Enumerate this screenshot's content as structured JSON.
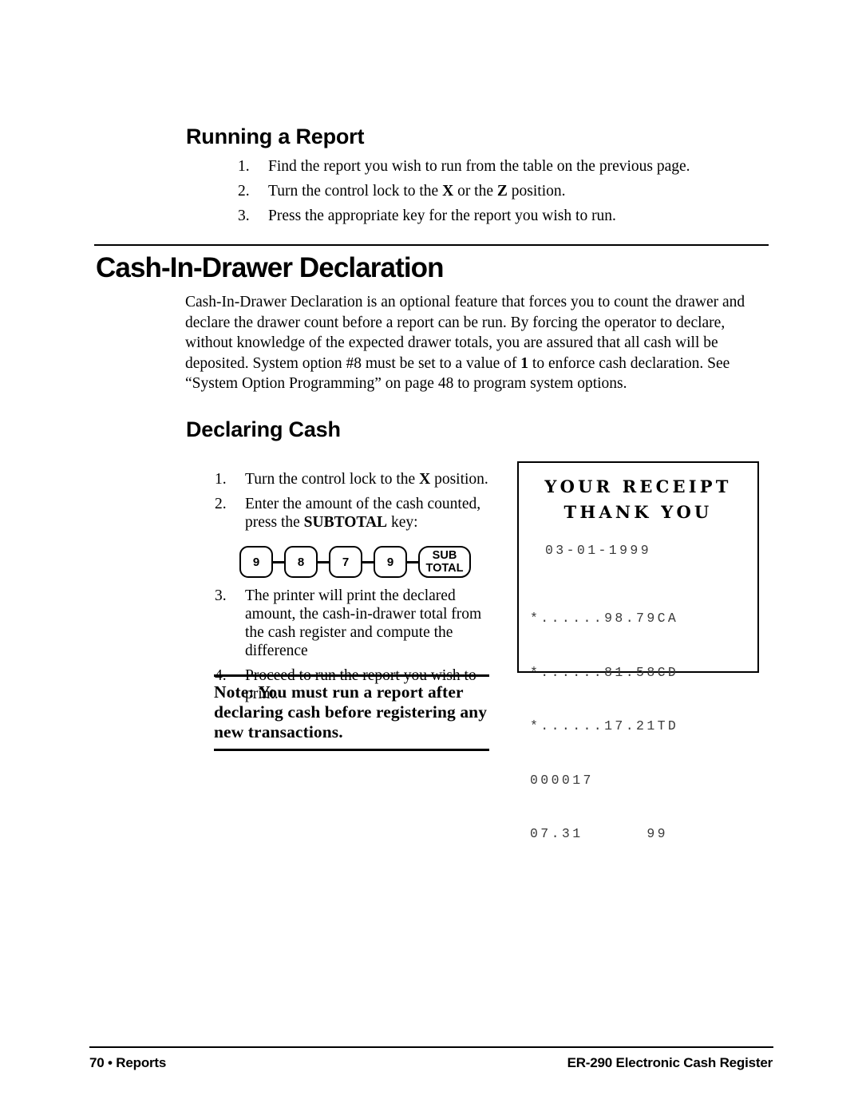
{
  "sections": {
    "running_report": {
      "heading": "Running a Report",
      "steps": [
        {
          "num": "1.",
          "text": "Find the report you wish to run from the table on the previous page."
        },
        {
          "num": "2.",
          "text_pre": "Turn the control lock to the ",
          "bold1": "X",
          "text_mid": " or the ",
          "bold2": "Z",
          "text_post": " position."
        },
        {
          "num": "3.",
          "text": "Press the appropriate key for the report you wish to run."
        }
      ]
    },
    "cash_in_drawer": {
      "heading": "Cash-In-Drawer Declaration",
      "paragraph_pre": "Cash-In-Drawer Declaration is an optional feature that forces you to count the drawer and declare the drawer count before a report can be run.  By forcing the operator to declare, without knowledge of the expected drawer totals, you are assured that all cash will be deposited.  System option #8 must be set to a value of ",
      "paragraph_bold": "1",
      "paragraph_post": " to enforce cash declaration.  See “System Option Programming” on page 48 to program system options."
    },
    "declaring_cash": {
      "heading": "Declaring Cash",
      "steps": [
        {
          "num": "1.",
          "text_pre": "Turn the control lock to the ",
          "bold1": "X",
          "text_post": " position."
        },
        {
          "num": "2.",
          "text_pre": "Enter the amount of the cash counted, press the ",
          "bold1": "SUBTOTAL",
          "text_post": " key:"
        },
        {
          "num": "3.",
          "text": "The printer will print the declared amount, the cash-in-drawer total from the cash register and compute the difference"
        },
        {
          "num": "4.",
          "text": "Proceed to run the report you wish to print."
        }
      ],
      "keys": [
        {
          "label": "9",
          "wide": false
        },
        {
          "label": "8",
          "wide": false
        },
        {
          "label": "7",
          "wide": false
        },
        {
          "label": "9",
          "wide": false
        },
        {
          "label_line1": "SUB",
          "label_line2": "TOTAL",
          "wide": true
        }
      ],
      "note": {
        "line1": "Note:  You must run a report after",
        "line2": "declaring cash before registering any",
        "line3": "new transactions."
      }
    }
  },
  "receipt": {
    "header_line1": "YOUR RECEIPT",
    "header_line2": "THANK YOU",
    "date": "03-01-1999",
    "lines": [
      "*......98.79CA",
      "*......81.58CD",
      "*......17.21TD",
      "000017",
      "07.31      99"
    ]
  },
  "footer": {
    "left": "70 •  Reports",
    "right": "ER-290 Electronic Cash Register"
  },
  "colors": {
    "text": "#000000",
    "receipt_text": "#3a3a3a",
    "rule": "#000000"
  }
}
